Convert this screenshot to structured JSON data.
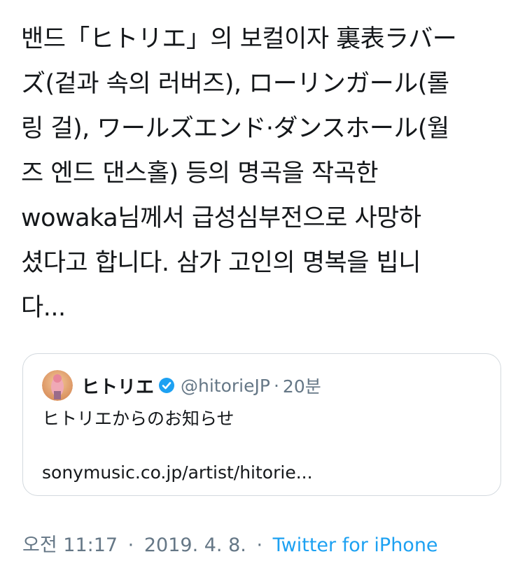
{
  "tweet": {
    "text_lines": [
      "밴드「ヒトリエ」의 보컬이자 裏表ラバー",
      "ズ(겉과 속의 러버즈), ローリンガール(롤",
      "링 걸), ワールズエンド·ダンスホール(월",
      "즈 엔드 댄스홀) 등의 명곡을 작곡한",
      "wowaka님께서 급성심부전으로 사망하",
      "셨다고 합니다. 삼가 고인의 명복을 빕니",
      "다..."
    ]
  },
  "quoted_tweet": {
    "display_name": "ヒトリエ",
    "handle": "@hitorieJP",
    "separator": "·",
    "time": "20분",
    "text": "ヒトリエからのお知らせ",
    "link": "sonymusic.co.jp/artist/hitorie..."
  },
  "footer": {
    "time": "오전 11:17",
    "separator_1": "·",
    "date": "2019. 4. 8.",
    "separator_2": "·",
    "source": "Twitter for iPhone"
  },
  "colors": {
    "text": "#14171a",
    "secondary": "#657786",
    "link": "#1da1f2",
    "border": "#d3d9de"
  },
  "icons": {
    "verified": "verified-badge-icon",
    "avatar": "avatar-image"
  }
}
